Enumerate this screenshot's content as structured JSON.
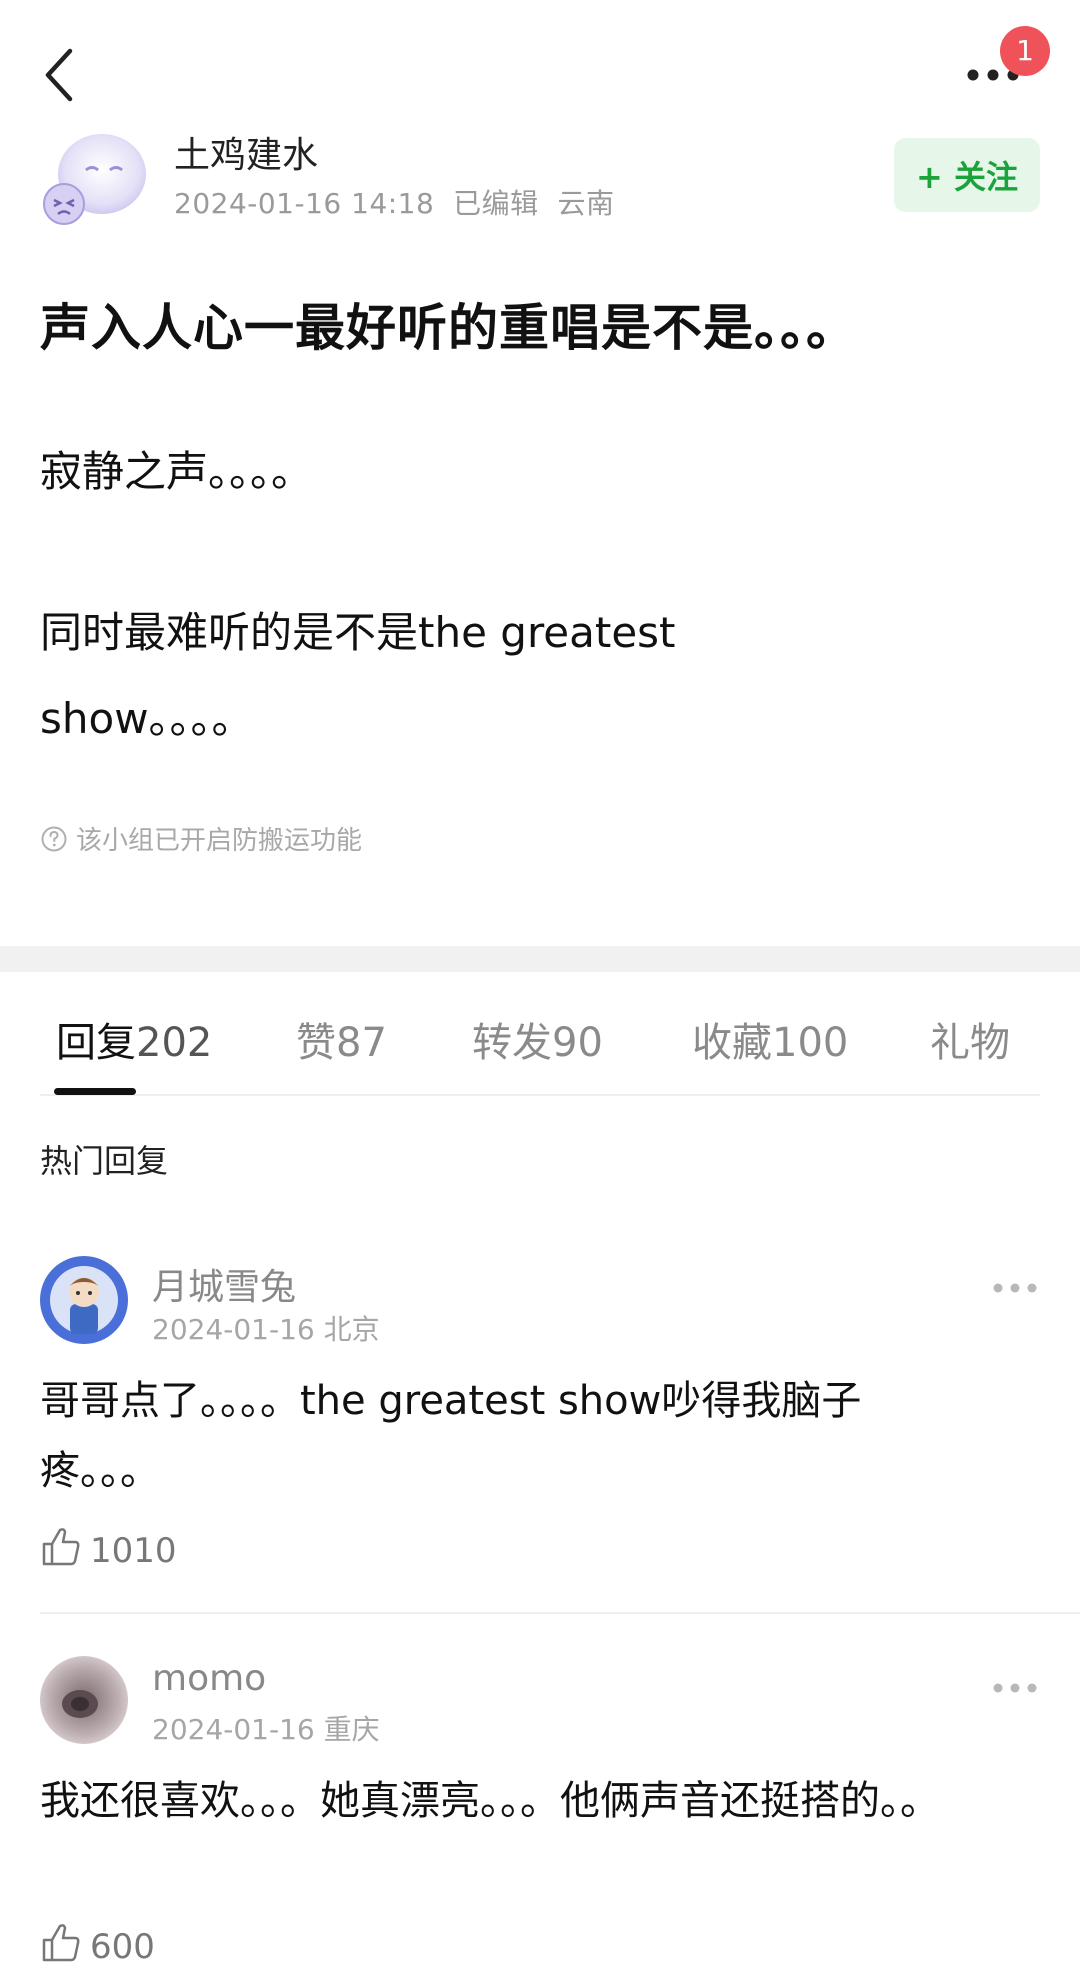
{
  "topbar": {
    "notification_count": "1"
  },
  "author": {
    "name": "土鸡建水",
    "timestamp": "2024-01-16 14:18",
    "edited": "已编辑",
    "location": "云南",
    "follow_label": "+ 关注"
  },
  "post": {
    "title": "声入人心一最好听的重唱是不是。。。",
    "paragraph1": "寂静之声。。。。",
    "paragraph2": "同时最难听的是不是the greatest show。。。。",
    "notice": "该小组已开启防搬运功能"
  },
  "tabs": [
    {
      "label": "回复",
      "count": "202"
    },
    {
      "label": "赞",
      "count": "87"
    },
    {
      "label": "转发",
      "count": "90"
    },
    {
      "label": "收藏",
      "count": "100"
    },
    {
      "label": "礼物",
      "count": ""
    }
  ],
  "hot_replies_title": "热门回复",
  "comments": [
    {
      "name": "月城雪兔",
      "date": "2024-01-16",
      "location": "北京",
      "text": "哥哥点了。。。。the greatest show吵得我脑子疼。。。",
      "likes": "1010"
    },
    {
      "name": "momo",
      "date": "2024-01-16",
      "location": "重庆",
      "text": "我还很喜欢。。。她真漂亮。。。他俩声音还挺搭的。。",
      "likes": "600"
    }
  ],
  "colors": {
    "follow_bg": "#e6f6e8",
    "follow_text": "#1aa33b",
    "badge": "#f0525a"
  }
}
